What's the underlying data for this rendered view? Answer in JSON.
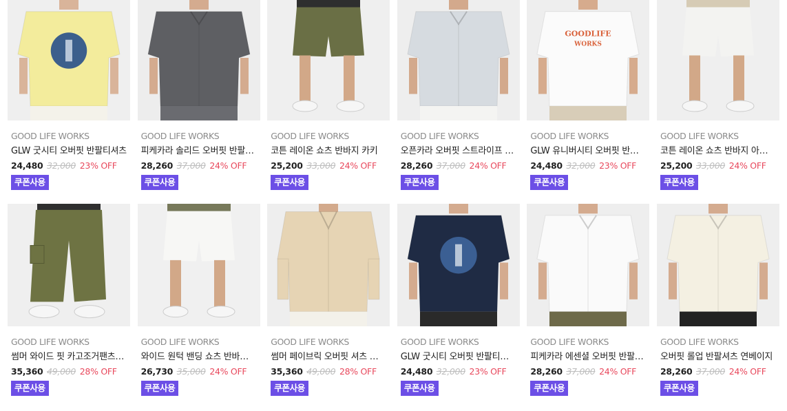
{
  "products": [
    {
      "brand": "GOOD LIFE WORKS",
      "name": "GLW 굿시티 오버핏 반팔티셔츠",
      "price": "24,480",
      "original": "32,000",
      "discount": "23% OFF",
      "coupon": "쿠폰사용",
      "image": {
        "bg": "#efefef",
        "top": "#f3ec9c",
        "bottom": "#f4f2ea",
        "skin": "#d9b49a",
        "kind": "tee-back",
        "graphic": "#3c5f8c"
      }
    },
    {
      "brand": "GOOD LIFE WORKS",
      "name": "피케카라 솔리드 오버핏 반팔셔츠",
      "price": "28,260",
      "original": "37,000",
      "discount": "24% OFF",
      "coupon": "쿠폰사용",
      "image": {
        "bg": "#ededed",
        "top": "#5e5f63",
        "bottom": "#6a6b70",
        "skin": "#d4ab8f",
        "kind": "shirt",
        "graphic": ""
      }
    },
    {
      "brand": "GOOD LIFE WORKS",
      "name": "코튼 레이온 쇼츠 반바지 카키",
      "price": "25,200",
      "original": "33,000",
      "discount": "24% OFF",
      "coupon": "쿠폰사용",
      "image": {
        "bg": "#efefef",
        "top": "#2e2e2e",
        "bottom": "#6a6f45",
        "skin": "#d2a888",
        "kind": "shorts",
        "graphic": ""
      }
    },
    {
      "brand": "GOOD LIFE WORKS",
      "name": "오픈카라 오버핏 스트라이프 반팔셔츠",
      "price": "28,260",
      "original": "37,000",
      "discount": "24% OFF",
      "coupon": "쿠폰사용",
      "image": {
        "bg": "#eeeeee",
        "top": "#d6dbe0",
        "bottom": "#f4f4f2",
        "skin": "#d3a98c",
        "kind": "shirt",
        "graphic": ""
      }
    },
    {
      "brand": "GOOD LIFE WORKS",
      "name": "GLW 유니버시티 오버핏 반팔티셔츠",
      "price": "24,480",
      "original": "32,000",
      "discount": "23% OFF",
      "coupon": "쿠폰사용",
      "image": {
        "bg": "#eeeeee",
        "top": "#fbfbfb",
        "bottom": "#d8cdb8",
        "skin": "#d6ab8d",
        "kind": "tee-front",
        "graphic": "#d9613a"
      }
    },
    {
      "brand": "GOOD LIFE WORKS",
      "name": "코튼 레이온 쇼츠 반바지 아이보리",
      "price": "25,200",
      "original": "33,000",
      "discount": "24% OFF",
      "coupon": "쿠폰사용",
      "image": {
        "bg": "#efefef",
        "top": "#d6cbb5",
        "bottom": "#f3f3f1",
        "skin": "#d2a888",
        "kind": "shorts",
        "graphic": ""
      }
    },
    {
      "brand": "GOOD LIFE WORKS",
      "name": "썸머 와이드 핏 카고조거팬츠 카키",
      "price": "35,360",
      "original": "49,000",
      "discount": "28% OFF",
      "coupon": "쿠폰사용",
      "image": {
        "bg": "#efefef",
        "top": "#2f2f2f",
        "bottom": "#6e7343",
        "skin": "#d2a888",
        "kind": "pants",
        "graphic": ""
      }
    },
    {
      "brand": "GOOD LIFE WORKS",
      "name": "와이드 원턱 밴딩 쇼츠 반바지 화이트",
      "price": "26,730",
      "original": "35,000",
      "discount": "24% OFF",
      "coupon": "쿠폰사용",
      "image": {
        "bg": "#f0f0f0",
        "top": "#77795a",
        "bottom": "#f7f7f5",
        "skin": "#d2a888",
        "kind": "shorts",
        "graphic": ""
      }
    },
    {
      "brand": "GOOD LIFE WORKS",
      "name": "썸머 페이브릭 오버핏 셔츠 베이지",
      "price": "35,360",
      "original": "49,000",
      "discount": "28% OFF",
      "coupon": "쿠폰사용",
      "image": {
        "bg": "#eeeeee",
        "top": "#e6d4b4",
        "bottom": "#f3f1ea",
        "skin": "#d3aa8c",
        "kind": "longshirt",
        "graphic": ""
      }
    },
    {
      "brand": "GOOD LIFE WORKS",
      "name": "GLW 굿시티 오버핏 반팔티셔츠 네이비",
      "price": "24,480",
      "original": "32,000",
      "discount": "23% OFF",
      "coupon": "쿠폰사용",
      "image": {
        "bg": "#eeeeee",
        "top": "#1f2b44",
        "bottom": "#2a2a2a",
        "skin": "#d4ab8f",
        "kind": "tee-back",
        "graphic": "#3b5f93"
      }
    },
    {
      "brand": "GOOD LIFE WORKS",
      "name": "피케카라 에센셜 오버핏 반팔셔츠",
      "price": "28,260",
      "original": "37,000",
      "discount": "24% OFF",
      "coupon": "쿠폰사용",
      "image": {
        "bg": "#eeeeee",
        "top": "#fafafa",
        "bottom": "#6e6a4a",
        "skin": "#d4ab8f",
        "kind": "shirt",
        "graphic": ""
      }
    },
    {
      "brand": "GOOD LIFE WORKS",
      "name": "오버핏 롤업 반팔셔츠 연베이지",
      "price": "28,260",
      "original": "37,000",
      "discount": "24% OFF",
      "coupon": "쿠폰사용",
      "image": {
        "bg": "#eeeeee",
        "top": "#f4f0e2",
        "bottom": "#222222",
        "skin": "#d4ab8f",
        "kind": "shirt",
        "graphic": ""
      }
    }
  ]
}
